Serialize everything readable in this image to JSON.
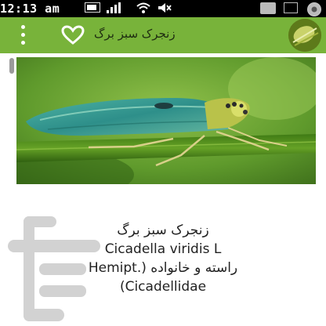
{
  "status_bar": {
    "time": "12:13 am",
    "icons": [
      "battery-icon",
      "signal-icon",
      "wifi-icon",
      "mute-icon",
      "gallery-icon",
      "app-icon",
      "chrome-icon"
    ]
  },
  "app_bar": {
    "title": "زنجرک سبز برگ",
    "menu_icon": "more-vertical-icon",
    "favorite_icon": "heart-outline-icon",
    "bg_color": "#78b33a"
  },
  "content": {
    "photo_subject": "green-leafhopper-photo",
    "description_lines": [
      "زنجرک سبز برگ",
      "Cicadella viridis L",
      "Hemipt.) راسته و خانواده",
      "(Cicadellidae"
    ]
  },
  "watermark": {
    "logo": "cafebazaar-logo"
  }
}
